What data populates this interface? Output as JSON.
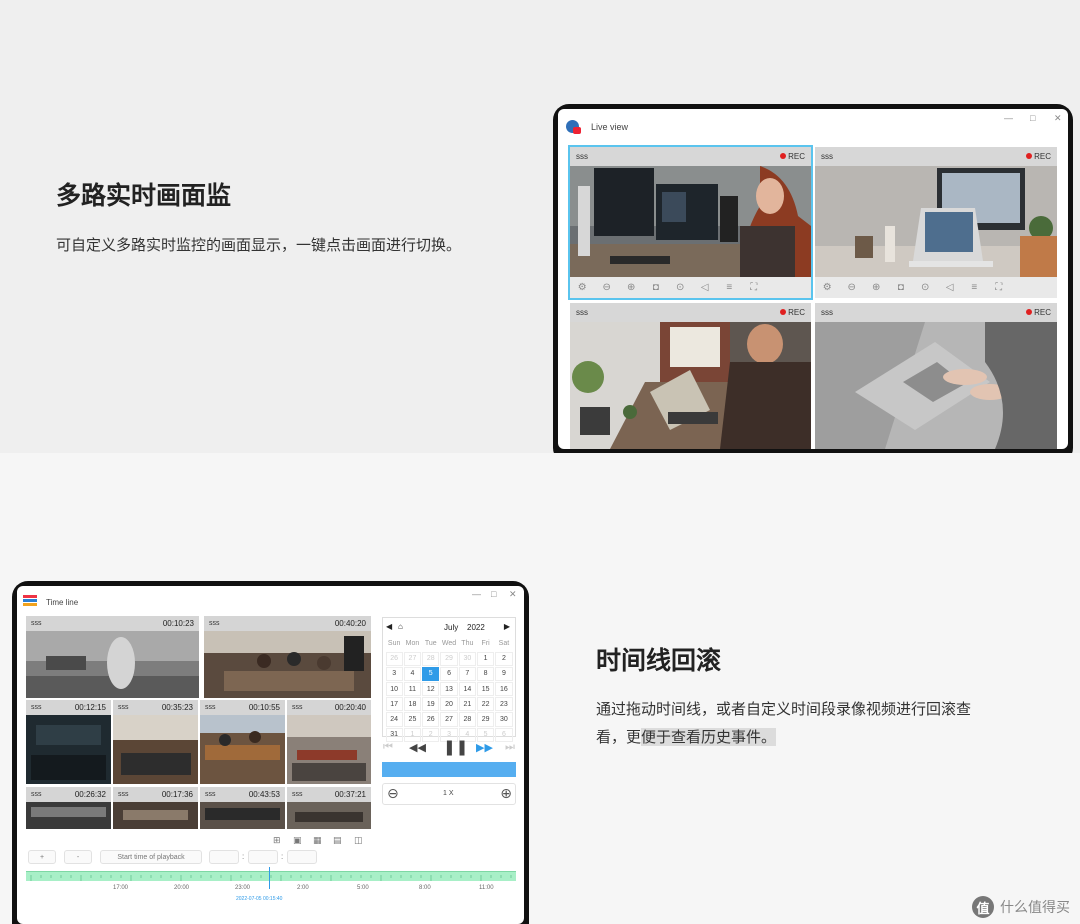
{
  "section1": {
    "title": "多路实时画面监",
    "desc": "可自定义多路实时监控的画面显示，一键点击画面进行切换。"
  },
  "live_view": {
    "window_title": "Live view",
    "tiles": [
      {
        "name": "sss",
        "status": "REC"
      },
      {
        "name": "sss",
        "status": "REC"
      },
      {
        "name": "sss",
        "status": "REC"
      },
      {
        "name": "sss",
        "status": "REC"
      }
    ],
    "toolbar_icons": [
      "settings-icon",
      "zoom-out-icon",
      "zoom-in-icon",
      "snapshot-icon",
      "record-icon",
      "volume-icon",
      "menu-icon",
      "fullscreen-icon"
    ],
    "colors": {
      "selected_border": "#5ac4ee",
      "rec_dot": "#e02020"
    }
  },
  "section2": {
    "title": "时间线回滚",
    "desc_line1": "通过拖动时间线，或者自定义时间段录像视频进行回滚查",
    "desc_line2_a": "看，更",
    "desc_line2_b": "便于查看历史事件。"
  },
  "timeline": {
    "window_title": "Time line",
    "big_tiles": [
      {
        "name": "sss",
        "time": "00:10:23"
      },
      {
        "name": "sss",
        "time": "00:40:20"
      }
    ],
    "small_tiles": [
      {
        "name": "sss",
        "time": "00:12:15"
      },
      {
        "name": "sss",
        "time": "00:35:23"
      },
      {
        "name": "sss",
        "time": "00:10:55"
      },
      {
        "name": "sss",
        "time": "00:20:40"
      },
      {
        "name": "sss",
        "time": "00:26:32"
      },
      {
        "name": "sss",
        "time": "00:17:36"
      },
      {
        "name": "sss",
        "time": "00:43:53"
      },
      {
        "name": "sss",
        "time": "00:37:21"
      }
    ],
    "calendar": {
      "month": "July",
      "year": "2022",
      "weekdays": [
        "Sun",
        "Mon",
        "Tue",
        "Wed",
        "Thu",
        "Fri",
        "Sat"
      ],
      "days": [
        [
          "26",
          "27",
          "28",
          "29",
          "30",
          "1",
          "2"
        ],
        [
          "3",
          "4",
          "5",
          "6",
          "7",
          "8",
          "9"
        ],
        [
          "10",
          "11",
          "12",
          "13",
          "14",
          "15",
          "16"
        ],
        [
          "17",
          "18",
          "19",
          "20",
          "21",
          "22",
          "23"
        ],
        [
          "24",
          "25",
          "26",
          "27",
          "28",
          "29",
          "30"
        ],
        [
          "31",
          "1",
          "2",
          "3",
          "4",
          "5",
          "6"
        ]
      ],
      "selected_day": "5"
    },
    "speed": "1 X",
    "plus_label": "+",
    "minus_label": "-",
    "start_time_label": "Start time of playback",
    "time_sep": ":",
    "ticks": [
      "17:00",
      "20:00",
      "23:00",
      "2:00",
      "5:00",
      "8:00",
      "11:00"
    ],
    "cursor_label": "2022-07-05 00:15:40",
    "colors": {
      "accent": "#2f9be8",
      "progress": "#56aef0",
      "timeline": "#a8efc7"
    }
  },
  "watermark": {
    "glyph": "值",
    "text": "什么值得买"
  }
}
